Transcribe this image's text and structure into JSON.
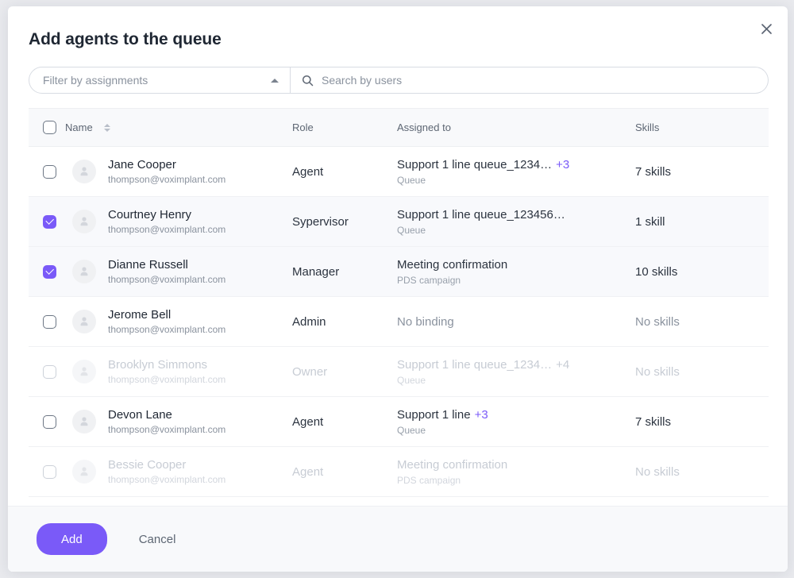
{
  "modal": {
    "title": "Add agents to the queue",
    "close_icon": "close-icon"
  },
  "filters": {
    "assignments_dropdown": {
      "label": "Filter by assignments",
      "caret_icon": "caret-up-icon"
    },
    "search": {
      "placeholder": "Search by users",
      "value": "",
      "icon": "search-icon"
    }
  },
  "table": {
    "columns": [
      {
        "key": "name",
        "label": "Name",
        "sortable": true
      },
      {
        "key": "role",
        "label": "Role",
        "sortable": false
      },
      {
        "key": "assigned",
        "label": "Assigned to",
        "sortable": false
      },
      {
        "key": "skills",
        "label": "Skills",
        "sortable": false
      }
    ],
    "header_select_all_checked": false,
    "rows": [
      {
        "name": "Jane Cooper",
        "email": "thompson@voximplant.com",
        "role": "Agent",
        "assigned_main": "Support 1 line queue_1234…",
        "assigned_badge": "+3",
        "assigned_sub": "Queue",
        "skills": "7 skills",
        "skills_muted": false,
        "assigned_muted": false,
        "checked": false,
        "disabled": false
      },
      {
        "name": "Courtney Henry",
        "email": "thompson@voximplant.com",
        "role": "Sypervisor",
        "assigned_main": "Support 1 line queue_123456…",
        "assigned_badge": "",
        "assigned_sub": "Queue",
        "skills": "1 skill",
        "skills_muted": false,
        "assigned_muted": false,
        "checked": true,
        "disabled": false
      },
      {
        "name": "Dianne Russell",
        "email": "thompson@voximplant.com",
        "role": "Manager",
        "assigned_main": "Meeting confirmation",
        "assigned_badge": "",
        "assigned_sub": "PDS campaign",
        "skills": "10 skills",
        "skills_muted": false,
        "assigned_muted": false,
        "checked": true,
        "disabled": false
      },
      {
        "name": "Jerome Bell",
        "email": "thompson@voximplant.com",
        "role": "Admin",
        "assigned_main": "No binding",
        "assigned_badge": "",
        "assigned_sub": "",
        "skills": "No skills",
        "skills_muted": true,
        "assigned_muted": true,
        "checked": false,
        "disabled": false
      },
      {
        "name": "Brooklyn Simmons",
        "email": "thompson@voximplant.com",
        "role": "Owner",
        "assigned_main": "Support 1 line queue_1234…",
        "assigned_badge": "+4",
        "assigned_sub": "Queue",
        "skills": "No skills",
        "skills_muted": true,
        "assigned_muted": false,
        "checked": false,
        "disabled": true
      },
      {
        "name": "Devon Lane",
        "email": "thompson@voximplant.com",
        "role": "Agent",
        "assigned_main": "Support 1 line",
        "assigned_badge": "+3",
        "assigned_sub": "Queue",
        "skills": "7 skills",
        "skills_muted": false,
        "assigned_muted": false,
        "checked": false,
        "disabled": false
      },
      {
        "name": "Bessie Cooper",
        "email": "thompson@voximplant.com",
        "role": "Agent",
        "assigned_main": "Meeting confirmation",
        "assigned_badge": "",
        "assigned_sub": "PDS campaign",
        "skills": "No skills",
        "skills_muted": true,
        "assigned_muted": false,
        "checked": false,
        "disabled": true
      }
    ]
  },
  "footer": {
    "add_label": "Add",
    "cancel_label": "Cancel"
  },
  "colors": {
    "accent": "#7a5af8",
    "text_primary": "#1f2733",
    "text_muted": "#8a929e",
    "row_selected_bg": "#f8f9fc",
    "footer_bg": "#f8f9fb"
  }
}
